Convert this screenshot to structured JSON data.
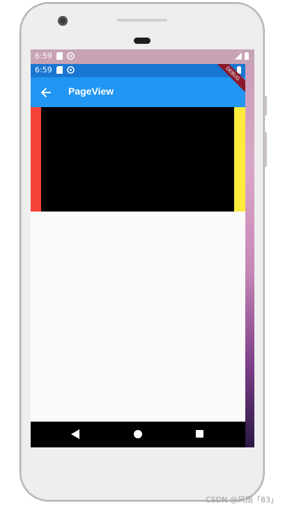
{
  "device": {
    "outer_status_time": "6:59",
    "inner_status_time": "6:59"
  },
  "appbar": {
    "title": "PageView",
    "back_icon": "arrow-back-icon",
    "debug_banner": "DEBUG",
    "color": "#2196f3"
  },
  "pageview": {
    "pages": [
      {
        "color": "#f44336"
      },
      {
        "color": "#000000"
      },
      {
        "color": "#ffeb3b"
      }
    ]
  },
  "navigation": {
    "back_icon": "triangle-back-icon",
    "home_icon": "circle-home-icon",
    "recent_icon": "square-recents-icon"
  },
  "watermark": "CSDN @风雨「83」"
}
